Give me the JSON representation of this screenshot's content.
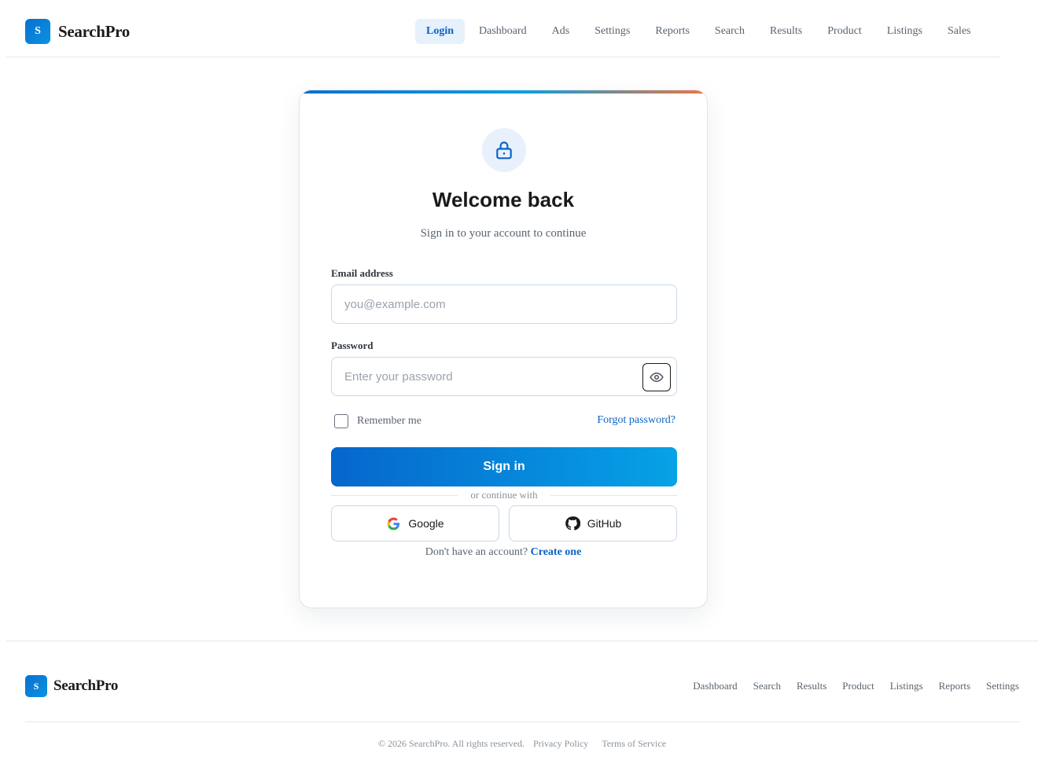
{
  "header": {
    "logo_letter": "S",
    "brand": "SearchPro",
    "nav": [
      {
        "label": "Login",
        "active": true
      },
      {
        "label": "Dashboard"
      },
      {
        "label": "Ads"
      },
      {
        "label": "Settings"
      },
      {
        "label": "Reports"
      },
      {
        "label": "Search"
      },
      {
        "label": "Results"
      },
      {
        "label": "Product"
      },
      {
        "label": "Listings"
      },
      {
        "label": "Sales"
      }
    ]
  },
  "login": {
    "icon": "lock-icon",
    "title": "Welcome back",
    "subtitle": "Sign in to your account to continue",
    "email": {
      "label": "Email address",
      "placeholder": "you@example.com",
      "value": ""
    },
    "password": {
      "label": "Password",
      "placeholder": "Enter your password",
      "value": "",
      "toggle_icon": "eye-icon"
    },
    "remember_label": "Remember me",
    "remember_checked": false,
    "forgot_label": "Forgot password?",
    "signin_label": "Sign in",
    "divider_text": "or continue with",
    "google_label": "Google",
    "github_label": "GitHub",
    "signup_prompt": "Don't have an account?",
    "signup_link": "Create one"
  },
  "footer": {
    "logo_letter": "S",
    "brand": "SearchPro",
    "links": [
      "Dashboard",
      "Search",
      "Results",
      "Product",
      "Listings",
      "Reports",
      "Settings"
    ],
    "copyright": "© 2026 SearchPro. All rights reserved.",
    "privacy": "Privacy Policy",
    "terms": "Terms of Service"
  },
  "colors": {
    "primary": "#0b63c5",
    "accent_gradient_start": "#0666cc",
    "accent_gradient_end": "#06a2e6",
    "top_bar_end": "#f0743c"
  }
}
